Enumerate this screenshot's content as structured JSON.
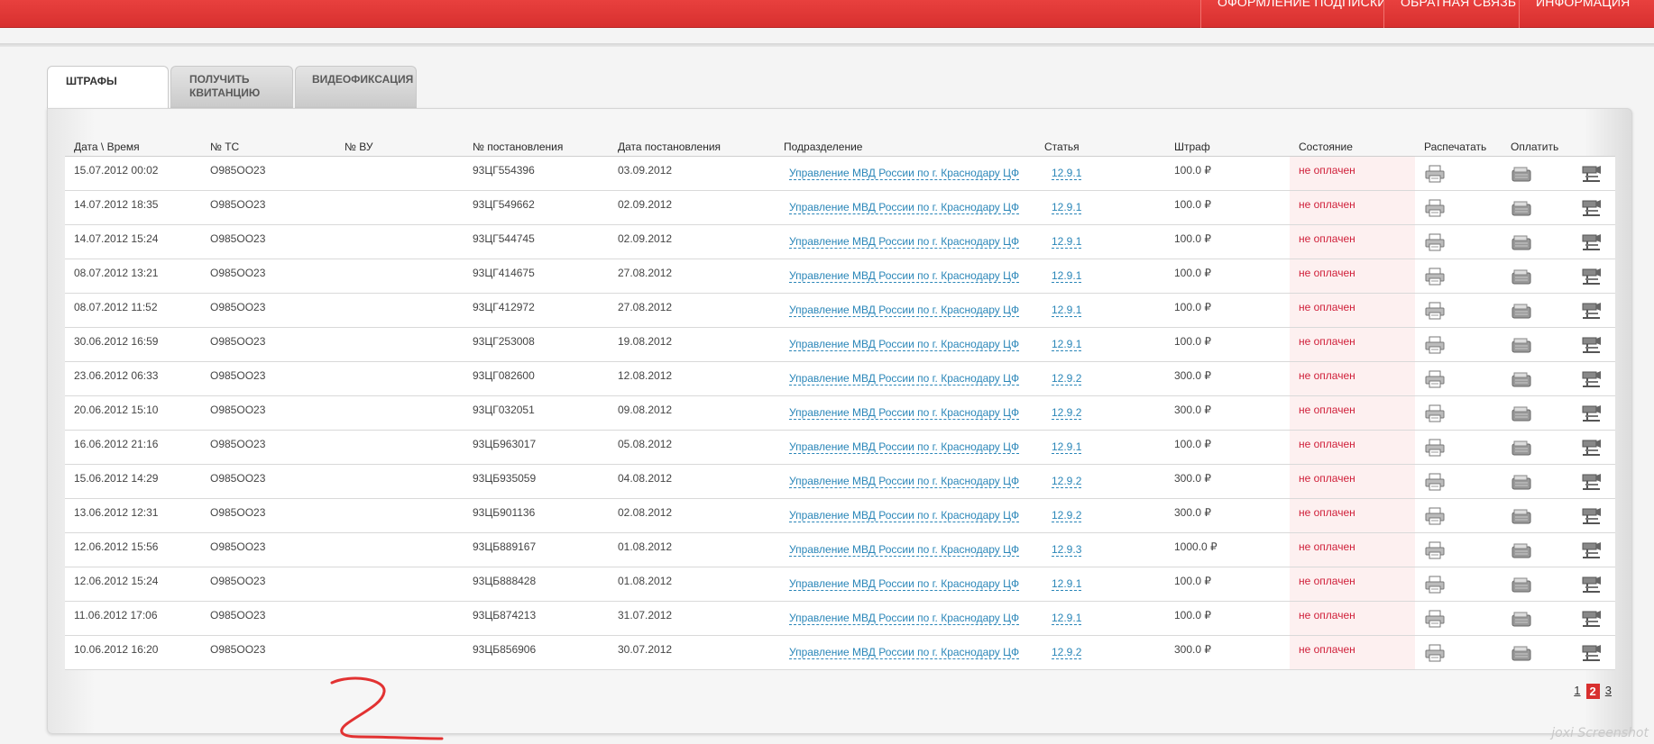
{
  "header": {
    "nav": [
      "ОФОРМЛЕНИЕ ПОДПИСКИ",
      "ОБРАТНАЯ СВЯЗЬ",
      "ИНФОРМАЦИЯ"
    ]
  },
  "tabs": [
    {
      "label": "ШТРАФЫ",
      "active": true
    },
    {
      "label": "ПОЛУЧИТЬ КВИТАНЦИЮ",
      "active": false
    },
    {
      "label": "ВИДЕОФИКСАЦИЯ",
      "active": false
    }
  ],
  "table": {
    "columns": [
      "Дата \\ Время",
      "№ ТС",
      "№ ВУ",
      "№ постановления",
      "Дата постановления",
      "Подразделение",
      "Статья",
      "Штраф",
      "Состояние",
      "Распечатать",
      "Оплатить",
      ""
    ],
    "rows": [
      {
        "datetime": "15.07.2012 00:02",
        "ts": "О985ОО23",
        "vu": "",
        "decree": "93ЦГ554396",
        "decree_date": "03.09.2012",
        "division": "Управление МВД России по г. Краснодару ЦФ",
        "article": "12.9.1",
        "fine": "100.0 ₽",
        "status": "не оплачен"
      },
      {
        "datetime": "14.07.2012 18:35",
        "ts": "О985ОО23",
        "vu": "",
        "decree": "93ЦГ549662",
        "decree_date": "02.09.2012",
        "division": "Управление МВД России по г. Краснодару ЦФ",
        "article": "12.9.1",
        "fine": "100.0 ₽",
        "status": "не оплачен"
      },
      {
        "datetime": "14.07.2012 15:24",
        "ts": "О985ОО23",
        "vu": "",
        "decree": "93ЦГ544745",
        "decree_date": "02.09.2012",
        "division": "Управление МВД России по г. Краснодару ЦФ",
        "article": "12.9.1",
        "fine": "100.0 ₽",
        "status": "не оплачен"
      },
      {
        "datetime": "08.07.2012 13:21",
        "ts": "О985ОО23",
        "vu": "",
        "decree": "93ЦГ414675",
        "decree_date": "27.08.2012",
        "division": "Управление МВД России по г. Краснодару ЦФ",
        "article": "12.9.1",
        "fine": "100.0 ₽",
        "status": "не оплачен"
      },
      {
        "datetime": "08.07.2012 11:52",
        "ts": "О985ОО23",
        "vu": "",
        "decree": "93ЦГ412972",
        "decree_date": "27.08.2012",
        "division": "Управление МВД России по г. Краснодару ЦФ",
        "article": "12.9.1",
        "fine": "100.0 ₽",
        "status": "не оплачен"
      },
      {
        "datetime": "30.06.2012 16:59",
        "ts": "О985ОО23",
        "vu": "",
        "decree": "93ЦГ253008",
        "decree_date": "19.08.2012",
        "division": "Управление МВД России по г. Краснодару ЦФ",
        "article": "12.9.1",
        "fine": "100.0 ₽",
        "status": "не оплачен"
      },
      {
        "datetime": "23.06.2012 06:33",
        "ts": "О985ОО23",
        "vu": "",
        "decree": "93ЦГ082600",
        "decree_date": "12.08.2012",
        "division": "Управление МВД России по г. Краснодару ЦФ",
        "article": "12.9.2",
        "fine": "300.0 ₽",
        "status": "не оплачен"
      },
      {
        "datetime": "20.06.2012 15:10",
        "ts": "О985ОО23",
        "vu": "",
        "decree": "93ЦГ032051",
        "decree_date": "09.08.2012",
        "division": "Управление МВД России по г. Краснодару ЦФ",
        "article": "12.9.2",
        "fine": "300.0 ₽",
        "status": "не оплачен"
      },
      {
        "datetime": "16.06.2012 21:16",
        "ts": "О985ОО23",
        "vu": "",
        "decree": "93ЦБ963017",
        "decree_date": "05.08.2012",
        "division": "Управление МВД России по г. Краснодару ЦФ",
        "article": "12.9.1",
        "fine": "100.0 ₽",
        "status": "не оплачен"
      },
      {
        "datetime": "15.06.2012 14:29",
        "ts": "О985ОО23",
        "vu": "",
        "decree": "93ЦБ935059",
        "decree_date": "04.08.2012",
        "division": "Управление МВД России по г. Краснодару ЦФ",
        "article": "12.9.2",
        "fine": "300.0 ₽",
        "status": "не оплачен"
      },
      {
        "datetime": "13.06.2012 12:31",
        "ts": "О985ОО23",
        "vu": "",
        "decree": "93ЦБ901136",
        "decree_date": "02.08.2012",
        "division": "Управление МВД России по г. Краснодару ЦФ",
        "article": "12.9.2",
        "fine": "300.0 ₽",
        "status": "не оплачен"
      },
      {
        "datetime": "12.06.2012 15:56",
        "ts": "О985ОО23",
        "vu": "",
        "decree": "93ЦБ889167",
        "decree_date": "01.08.2012",
        "division": "Управление МВД России по г. Краснодару ЦФ",
        "article": "12.9.3",
        "fine": "1000.0 ₽",
        "status": "не оплачен"
      },
      {
        "datetime": "12.06.2012 15:24",
        "ts": "О985ОО23",
        "vu": "",
        "decree": "93ЦБ888428",
        "decree_date": "01.08.2012",
        "division": "Управление МВД России по г. Краснодару ЦФ",
        "article": "12.9.1",
        "fine": "100.0 ₽",
        "status": "не оплачен"
      },
      {
        "datetime": "11.06.2012 17:06",
        "ts": "О985ОО23",
        "vu": "",
        "decree": "93ЦБ874213",
        "decree_date": "31.07.2012",
        "division": "Управление МВД России по г. Краснодару ЦФ",
        "article": "12.9.1",
        "fine": "100.0 ₽",
        "status": "не оплачен"
      },
      {
        "datetime": "10.06.2012 16:20",
        "ts": "О985ОО23",
        "vu": "",
        "decree": "93ЦБ856906",
        "decree_date": "30.07.2012",
        "division": "Управление МВД России по г. Краснодару ЦФ",
        "article": "12.9.2",
        "fine": "300.0 ₽",
        "status": "не оплачен"
      }
    ]
  },
  "pagination": {
    "pages": [
      "1",
      "2",
      "3"
    ],
    "current": "2"
  },
  "icons": {
    "print": "printer-icon",
    "pay": "wallet-icon",
    "video": "camera-icon"
  },
  "colors": {
    "brand_red": "#d8302f",
    "status_red": "#d0203a",
    "link_blue": "#2a86b8",
    "status_bg": "#fdf0f0"
  },
  "annotation": {
    "scribble": "hand-drawn-2"
  },
  "watermark": "joxi Screenshot"
}
